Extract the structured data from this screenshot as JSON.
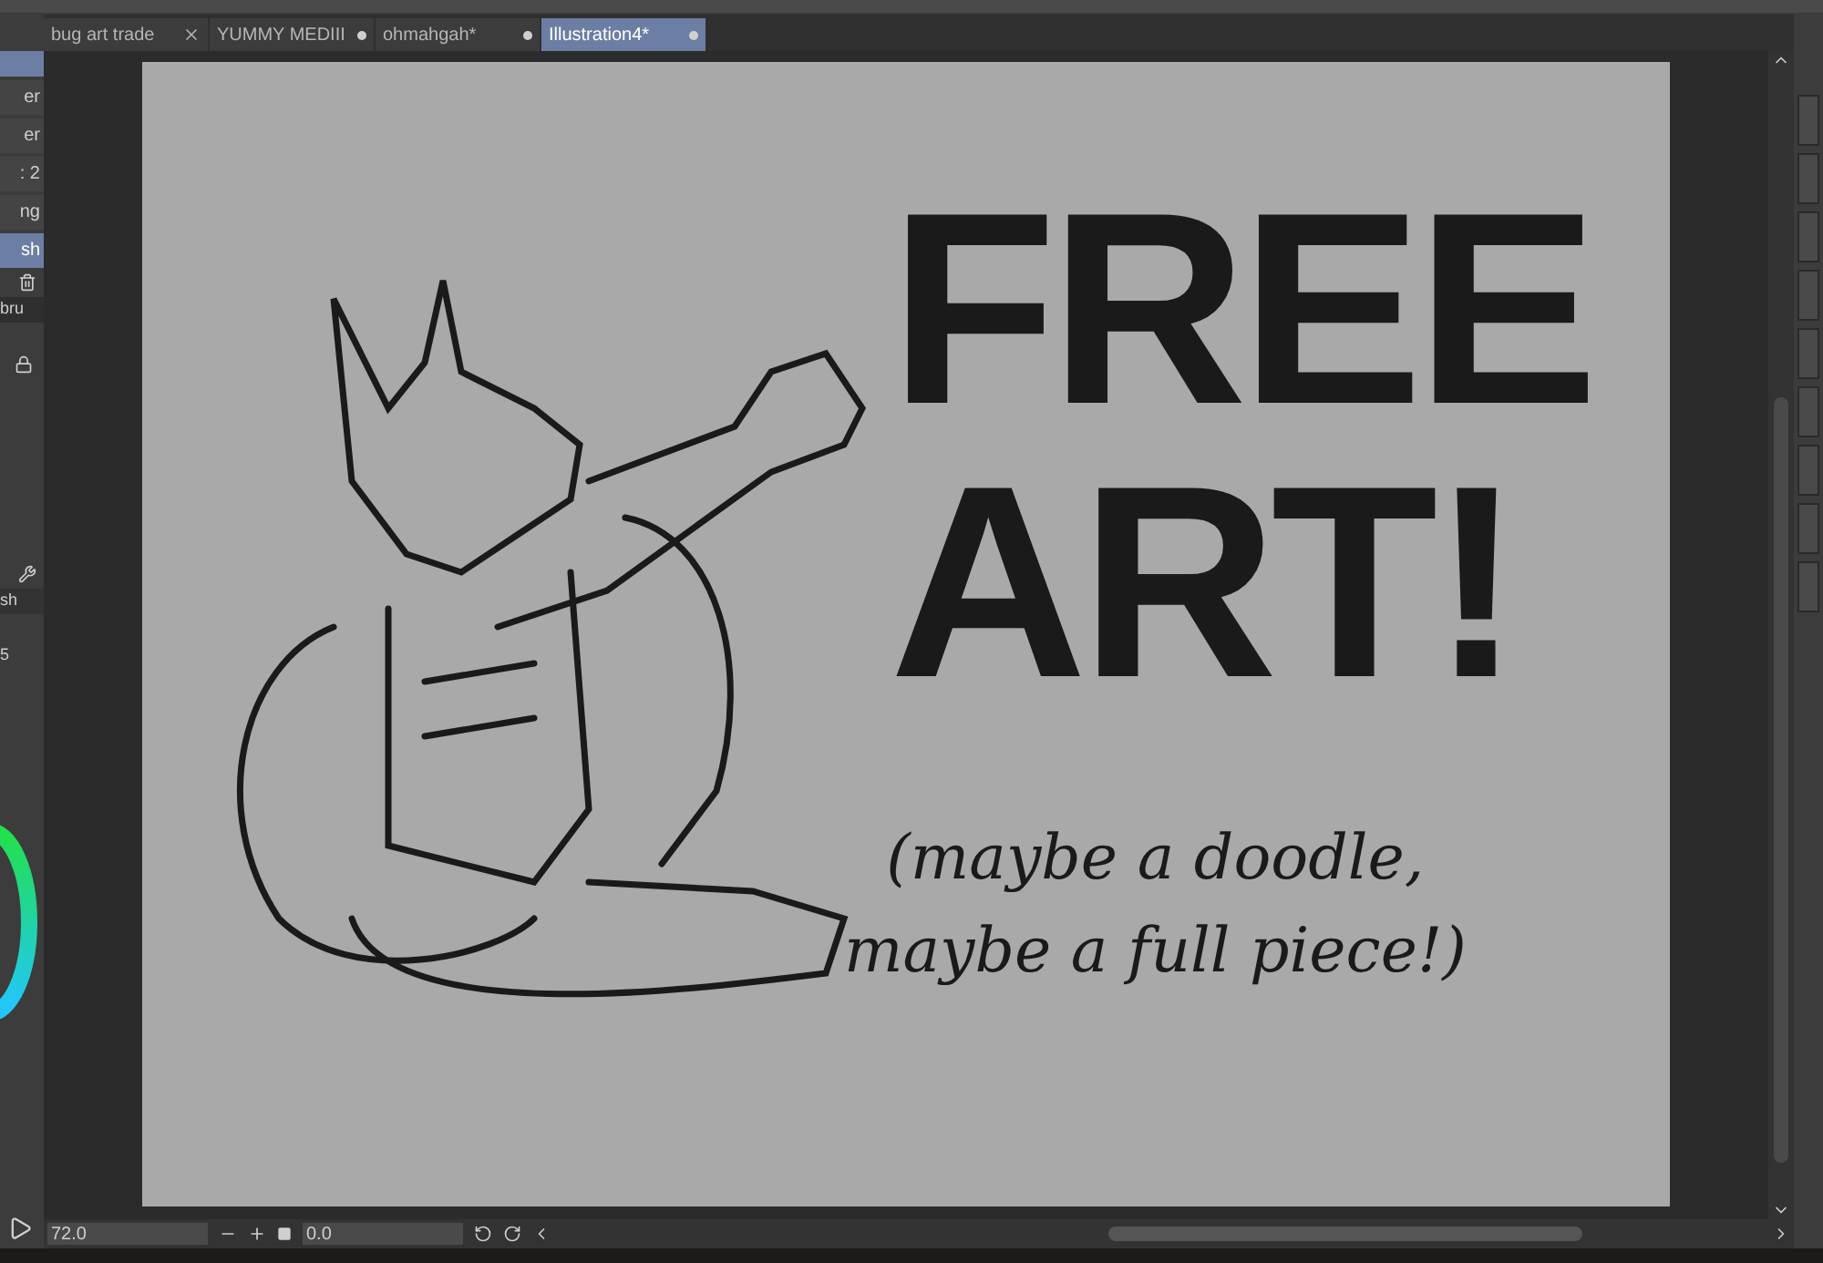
{
  "tabs": [
    {
      "label": "bug art trade",
      "selected": false,
      "kind": "close"
    },
    {
      "label": "YUMMY MEDIII",
      "selected": false,
      "kind": "dot"
    },
    {
      "label": "ohmahgah*",
      "selected": false,
      "kind": "dot"
    },
    {
      "label": "Illustration4*",
      "selected": true,
      "kind": "dot"
    }
  ],
  "left_panel": {
    "layers": [
      {
        "label": "er",
        "selected": false
      },
      {
        "label": "er",
        "selected": false
      },
      {
        "label": ": 2",
        "selected": false
      },
      {
        "label": "ng",
        "selected": false
      },
      {
        "label": "sh",
        "selected": true
      }
    ],
    "brush_field": "bru",
    "sub_tool_tab": "sh",
    "size_value": "5"
  },
  "canvas": {
    "headline": [
      "FREE",
      "ART!"
    ],
    "subtitle": [
      "(maybe a doodle,",
      "maybe a full piece!)"
    ]
  },
  "status_bar": {
    "zoom": "72.0",
    "rotation": "0.0"
  }
}
